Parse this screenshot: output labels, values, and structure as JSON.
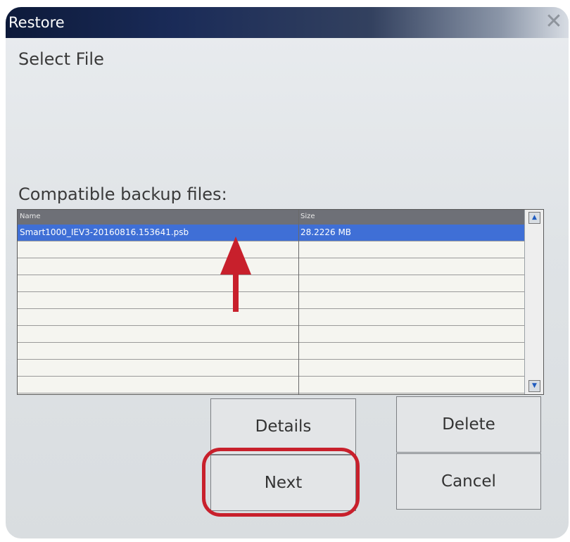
{
  "window": {
    "title": "Restore",
    "close_icon": "close-icon"
  },
  "page": {
    "heading": "Select File",
    "list_label": "Compatible backup files:"
  },
  "file_table": {
    "columns": [
      "Name",
      "Size"
    ],
    "rows": [
      {
        "name": "Smart1000_IEV3-20160816.153641.psb",
        "size": "28.2226 MB",
        "selected": true
      }
    ],
    "empty_rows": 9,
    "scroll_up_icon": "scroll-up-arrow-icon",
    "scroll_down_icon": "scroll-down-arrow-icon"
  },
  "buttons": {
    "details": "Details",
    "delete": "Delete",
    "next": "Next",
    "cancel": "Cancel"
  },
  "annotations": {
    "arrow_color": "#c8202c",
    "highlight_color": "#c8202c"
  },
  "colors": {
    "selection": "#3f6fd6",
    "header": "#6e7077",
    "titlebar": "#0d1a3a"
  }
}
